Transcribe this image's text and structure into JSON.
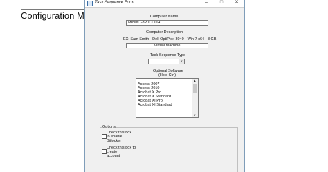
{
  "background_page": {
    "heading": "Configuration Manage"
  },
  "window": {
    "title": "Task Sequence Form",
    "controls": {
      "minimize": "–",
      "maximize": "□",
      "close": "✕"
    }
  },
  "form": {
    "computer_name": {
      "label": "Computer Name",
      "value": "MININT-8P0CDOH"
    },
    "computer_description": {
      "label": "Computer Description",
      "hint": "EX: Sam Smith - Dell OptiPlex 3040 - Win 7 x64 - 8 GB",
      "value": "Virtual Machine"
    },
    "task_sequence_type": {
      "label": "Task Sequence Type",
      "value": ""
    },
    "optional_software": {
      "label": "Optional Software",
      "sublabel": "(Hold Ctrl)",
      "items": [
        "Access 2007",
        "Access 2010",
        "Acrobat X Pro",
        "Acrobat X Standard",
        "Acrobat XI Pro",
        "Acrobat XI Standard"
      ]
    },
    "options": {
      "legend": "Options",
      "enable_bitlocker": {
        "lines": [
          "Check this box",
          "to enable",
          "Bitlocker"
        ],
        "checked": false
      },
      "create_account": {
        "lines": [
          "Check this box to",
          "create",
          "account"
        ],
        "checked": false
      }
    }
  }
}
